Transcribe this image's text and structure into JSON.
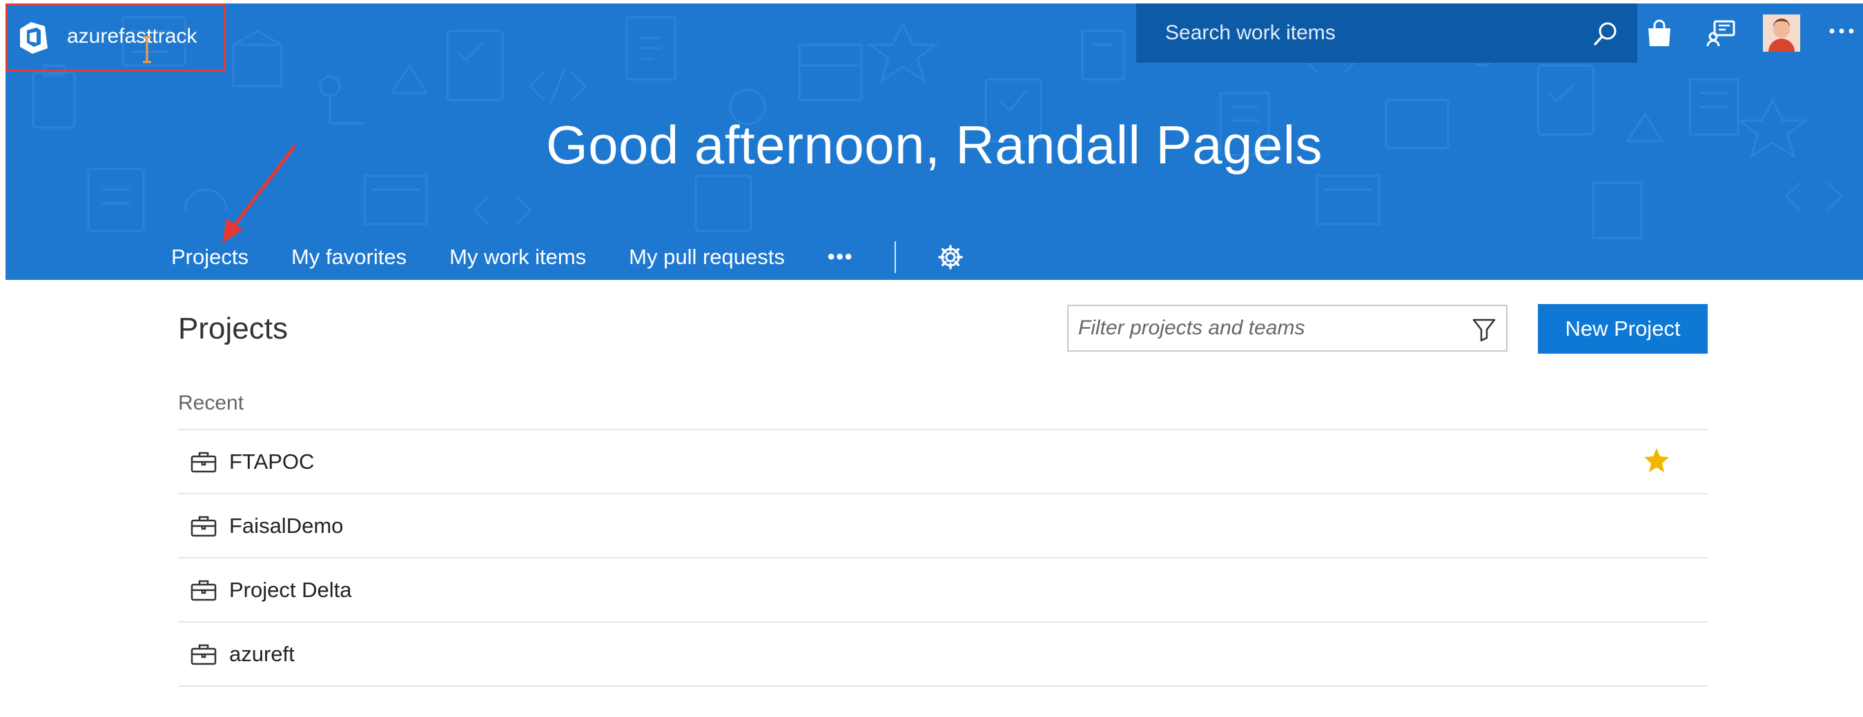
{
  "header": {
    "org_name": "azurefasttrack",
    "search_placeholder": "Search work items",
    "greeting": "Good afternoon, Randall Pagels",
    "icons": [
      "azure-devops-logo-icon",
      "search-icon",
      "shopping-bag-icon",
      "feedback-icon",
      "avatar",
      "more-icon"
    ]
  },
  "nav": {
    "tabs": [
      {
        "label": "Projects",
        "active": true
      },
      {
        "label": "My favorites",
        "active": false
      },
      {
        "label": "My work items",
        "active": false
      },
      {
        "label": "My pull requests",
        "active": false
      }
    ],
    "more_label": "•••"
  },
  "main": {
    "title": "Projects",
    "filter_placeholder": "Filter projects and teams",
    "new_project_label": "New Project",
    "recent_label": "Recent",
    "projects": [
      {
        "name": "FTAPOC",
        "favorite": true
      },
      {
        "name": "FaisalDemo",
        "favorite": false
      },
      {
        "name": "Project Delta",
        "favorite": false
      },
      {
        "name": "azureft",
        "favorite": false
      }
    ]
  },
  "colors": {
    "banner": "#1e78cf",
    "search_bg": "#0d5aa7",
    "primary_button": "#0f78d4",
    "favorite_star": "#f2b600",
    "annotation": "#e53935"
  }
}
